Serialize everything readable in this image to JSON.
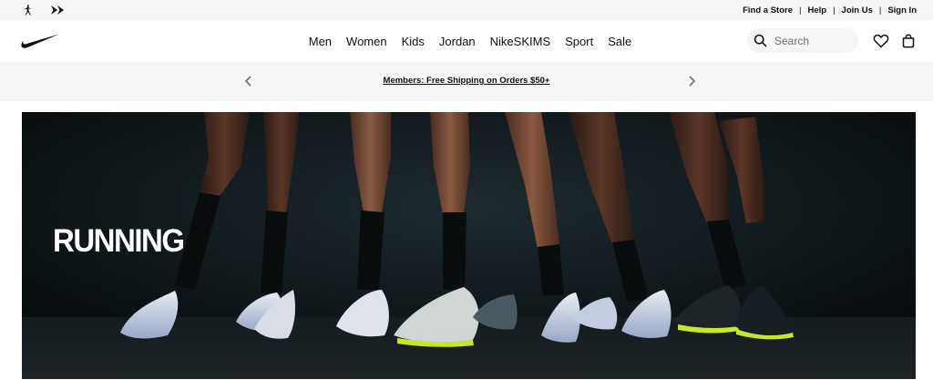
{
  "utility": {
    "brands": [
      "jordan-logo",
      "converse-logo"
    ],
    "links": [
      "Find a Store",
      "Help",
      "Join Us",
      "Sign In"
    ],
    "separator": "|"
  },
  "nav": {
    "logo": "nike-swoosh-logo",
    "items": [
      "Men",
      "Women",
      "Kids",
      "Jordan",
      "NikeSKIMS",
      "Sport",
      "Sale"
    ],
    "search_placeholder": "Search"
  },
  "promo": {
    "message": "Members: Free Shipping on Orders $50+"
  },
  "hero": {
    "title": "RUNNING"
  },
  "colors": {
    "utility_bg": "#f5f5f5",
    "promo_bg": "#f5f5f5",
    "hero_bg": "#0b1012",
    "text": "#111111",
    "volt": "#c7e82a"
  }
}
